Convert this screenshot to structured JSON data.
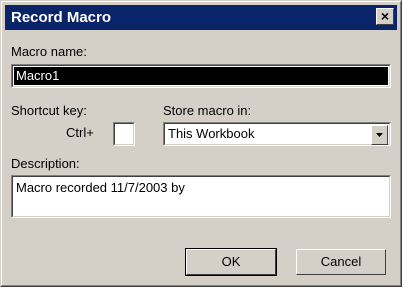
{
  "window": {
    "title": "Record Macro",
    "close_label": "×"
  },
  "macro_name": {
    "label": "Macro name:",
    "value": "Macro1"
  },
  "shortcut": {
    "label": "Shortcut key:",
    "prefix": "Ctrl+",
    "value": ""
  },
  "store_in": {
    "label": "Store macro in:",
    "selected": "This Workbook"
  },
  "description": {
    "label": "Description:",
    "value": "Macro recorded 11/7/2003 by"
  },
  "buttons": {
    "ok": "OK",
    "cancel": "Cancel"
  },
  "colors": {
    "titlebar": "#0a246a",
    "dialog_bg": "#d4d0c8"
  }
}
